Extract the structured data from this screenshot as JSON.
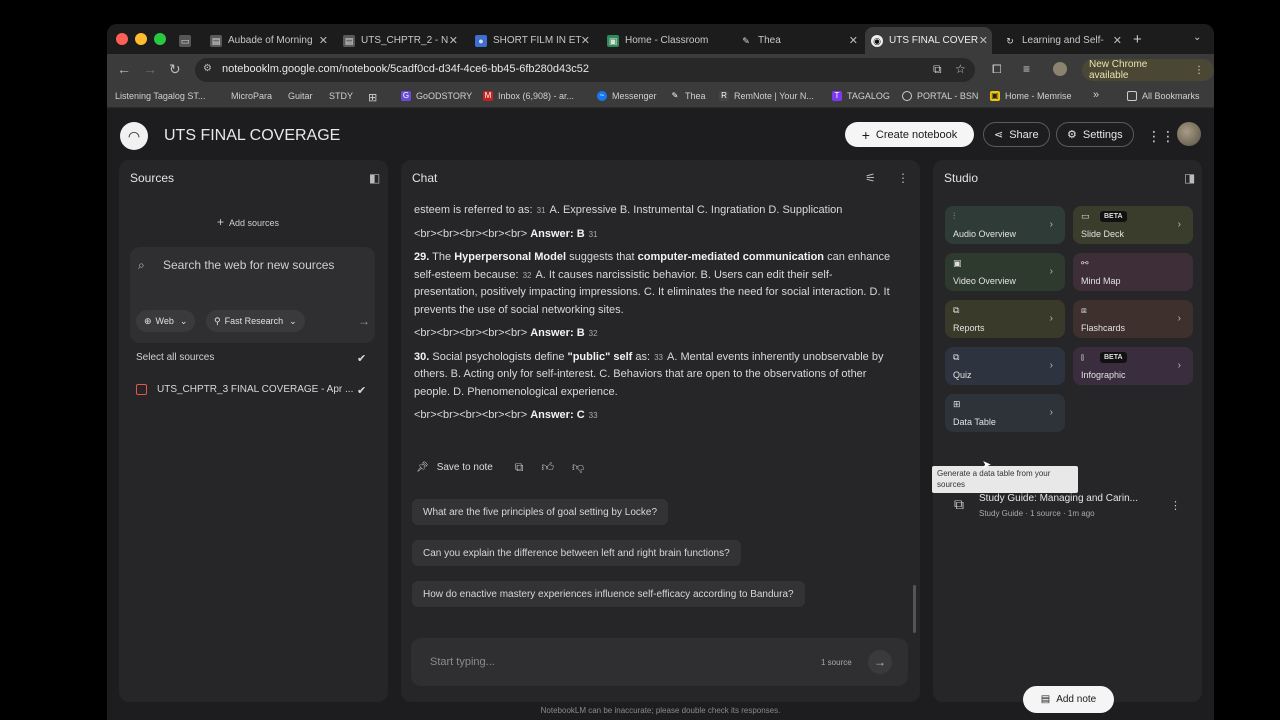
{
  "browser": {
    "tabs": [
      {
        "label": "Aubade of Morning",
        "icon": "doc-icon"
      },
      {
        "label": "UTS_CHPTR_2 - N",
        "icon": "doc-icon"
      },
      {
        "label": "SHORT FILM IN ET",
        "icon": "person-icon"
      },
      {
        "label": "Home - Classroom",
        "icon": "classroom-icon"
      },
      {
        "label": "Thea",
        "icon": "feather-icon"
      },
      {
        "label": "UTS FINAL COVER",
        "icon": "notebooklm-icon"
      },
      {
        "label": "Learning and Self-",
        "icon": "learning-icon"
      }
    ],
    "url": "notebooklm.google.com/notebook/5cadf0cd-d34f-4ce6-bb45-6fb280d43c52",
    "new_chrome_label": "New Chrome available",
    "bookmarks": [
      "Listening Tagalog ST...",
      "MicroPara",
      "Guitar",
      "STDY",
      "GoODSTORY",
      "Inbox (6,908) - ar...",
      "Messenger",
      "Thea",
      "RemNote | Your N...",
      "TAGALOG",
      "PORTAL - BSN",
      "Home - Memrise"
    ],
    "all_bookmarks": "All Bookmarks",
    "overflow": "»"
  },
  "header": {
    "title": "UTS FINAL COVERAGE",
    "create_notebook": "Create notebook",
    "share": "Share",
    "settings": "Settings"
  },
  "sources": {
    "heading": "Sources",
    "add_sources": "Add sources",
    "search_placeholder": "Search the web for new sources",
    "web_chip": "Web",
    "research_chip": "Fast Research",
    "select_all": "Select all sources",
    "items": [
      "UTS_CHPTR_3 FINAL COVERAGE - Apr ..."
    ]
  },
  "chat": {
    "heading": "Chat",
    "line1_text": "esteem is referred to as:",
    "line1_cite": "31",
    "line1_rest": "A. Expressive B. Instrumental C. Ingratiation D. Supplication",
    "ans1_br": "<br><br><br><br><br>",
    "ans_label": "Answer:",
    "ans1": "B",
    "ans1_cite": "31",
    "q29_num": "29.",
    "q29_a": "The",
    "q29_b": "Hyperpersonal Model",
    "q29_c": "suggests that",
    "q29_d": "computer-mediated communication",
    "q29_e": "can enhance self-esteem because:",
    "q29_cite": "32",
    "q29_rest": "A. It causes narcissistic behavior. B. Users can edit their self-presentation, positively impacting impressions. C. It eliminates the need for social interaction. D. It prevents the use of social networking sites.",
    "ans2": "B",
    "ans2_cite": "32",
    "q30_num": "30.",
    "q30_a": "Social psychologists define",
    "q30_b": "\"public\" self",
    "q30_c": "as:",
    "q30_cite": "33",
    "q30_rest": "A. Mental events inherently unobservable by others. B. Acting only for self-interest. C. Behaviors that are open to the observations of other people. D. Phenomenological experience.",
    "ans3": "C",
    "ans3_cite": "33",
    "save_to_note": "Save to note",
    "suggestions": [
      "What are the five principles of goal setting by Locke?",
      "Can you explain the difference between left and right brain functions?",
      "How do enactive mastery experiences influence self-efficacy according to Bandura?"
    ],
    "input_placeholder": "Start typing...",
    "source_count": "1 source"
  },
  "studio": {
    "heading": "Studio",
    "tiles": [
      {
        "label": "Audio Overview",
        "color": "#2f3b36",
        "beta": false
      },
      {
        "label": "Slide Deck",
        "color": "#3b3d2c",
        "beta": true
      },
      {
        "label": "Video Overview",
        "color": "#2e3a2d",
        "beta": false
      },
      {
        "label": "Mind Map",
        "color": "#3d2e38",
        "beta": false
      },
      {
        "label": "Reports",
        "color": "#3a3a2a",
        "beta": false
      },
      {
        "label": "Flashcards",
        "color": "#3e302d",
        "beta": false
      },
      {
        "label": "Quiz",
        "color": "#2d3440",
        "beta": false
      },
      {
        "label": "Infographic",
        "color": "#3a2e3e",
        "beta": true
      },
      {
        "label": "Data Table",
        "color": "#2e3239",
        "beta": false
      }
    ],
    "beta_label": "BETA",
    "tooltip": "Generate a data table from your sources",
    "note_title": "Study Guide: Managing and Carin...",
    "note_meta": "Study Guide · 1 source · 1m ago",
    "add_note": "Add note"
  },
  "footer": "NotebookLM can be inaccurate; please double check its responses."
}
